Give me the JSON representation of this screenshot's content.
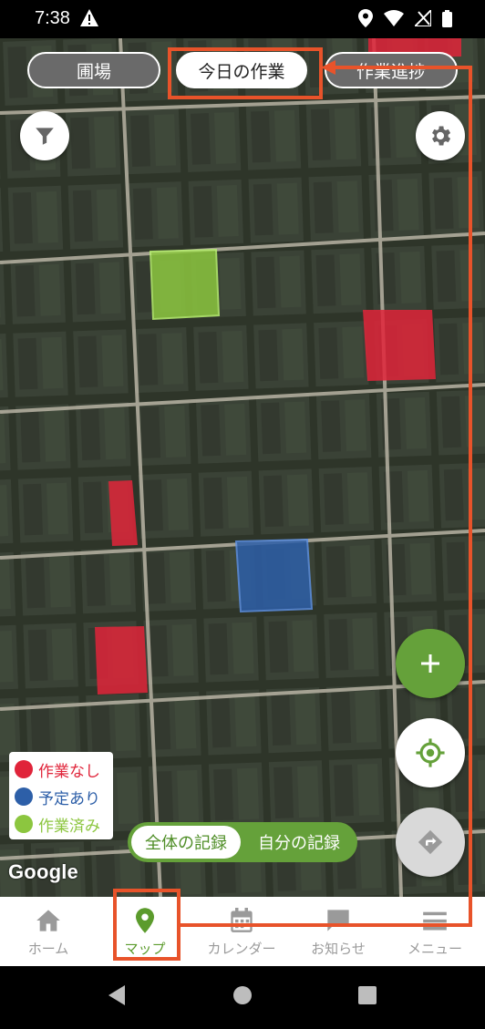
{
  "status_bar": {
    "time": "7:38"
  },
  "tabs": [
    {
      "label": "圃場"
    },
    {
      "label": "今日の作業"
    },
    {
      "label": "作業進捗"
    }
  ],
  "colors": {
    "accent_green": "#65a13a",
    "status_none": "#e0243a",
    "status_planned": "#2d5fa8",
    "status_done": "#8cc63f",
    "annotation": "#e8532a"
  },
  "map": {
    "attribution": "Google",
    "legend": [
      {
        "label": "作業なし",
        "color": "#e0243a"
      },
      {
        "label": "予定あり",
        "color": "#2d5fa8"
      },
      {
        "label": "作業済み",
        "color": "#8cc63f"
      }
    ],
    "record_toggle": {
      "all": "全体の記録",
      "mine": "自分の記録",
      "selected": "全体の記録"
    },
    "buttons": {
      "filter": "filter-icon",
      "settings": "gear-icon",
      "add": "plus-icon",
      "locate": "gps-target-icon",
      "route": "directions-icon"
    }
  },
  "bottom_nav": {
    "active": "マップ",
    "items": [
      {
        "label": "ホーム",
        "icon": "home-icon"
      },
      {
        "label": "マップ",
        "icon": "map-pin-icon"
      },
      {
        "label": "カレンダー",
        "icon": "calendar-icon"
      },
      {
        "label": "お知らせ",
        "icon": "chat-bubble-icon"
      },
      {
        "label": "メニュー",
        "icon": "menu-icon"
      }
    ]
  }
}
